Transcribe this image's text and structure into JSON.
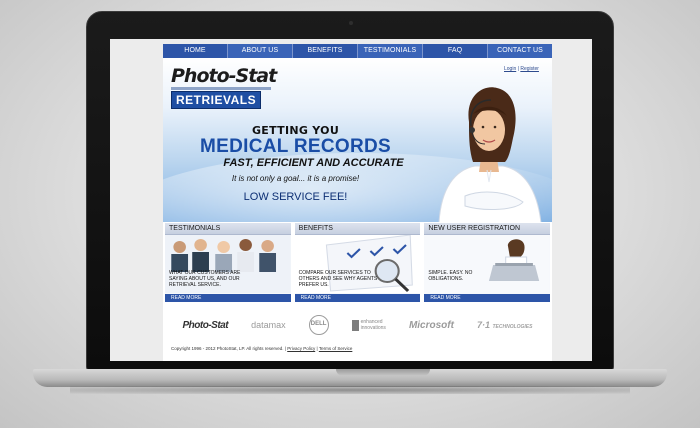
{
  "nav": {
    "items": [
      "HOME",
      "ABOUT US",
      "BENEFITS",
      "TESTIMONIALS",
      "FAQ",
      "CONTACT US"
    ]
  },
  "header": {
    "logo_top": "Photo-Stat",
    "logo_bottom": "RETRIEVALS",
    "login_label": "Login",
    "separator": "|",
    "register_label": "Register"
  },
  "hero": {
    "line1": "GETTING YOU",
    "line2": "MEDICAL RECORDS",
    "line3": "FAST, EFFICIENT AND ACCURATE",
    "line4": "It is not only a goal... it is a promise!",
    "line5": "LOW SERVICE FEE!"
  },
  "panels": [
    {
      "title": "TESTIMONIALS",
      "body": "WHAT OUR CUSTOMERS ARE SAYING ABOUT US, AND OUR RETRIEVAL SERVICE.",
      "more": "READ MORE"
    },
    {
      "title": "BENEFITS",
      "body": "COMPARE OUR SERVICES TO OTHERS AND SEE WHY AGENTS PREFER US.",
      "more": "READ MORE"
    },
    {
      "title": "NEW USER REGISTRATION",
      "body": "SIMPLE. EASY. NO OBLIGATIONS.",
      "more": "READ MORE"
    }
  ],
  "partners": {
    "photostat": "Photo-Stat",
    "datamax": "datamax",
    "dell": "DELL",
    "enhanced_top": "enhanced",
    "enhanced_bottom": "innovations",
    "microsoft": "Microsoft",
    "tech": "TECHNOLOGIES"
  },
  "footer": {
    "copyright": "Copyright 1996 - 2012 PhotoStat, LP. All rights reserved.",
    "sep1": "|",
    "privacy": "Privacy Policy",
    "sep2": "|",
    "terms": "Terms of Service"
  },
  "colors": {
    "nav_blue": "#2d55a8",
    "headline_blue": "#1a4da6",
    "laptop_frame": "#111111"
  }
}
